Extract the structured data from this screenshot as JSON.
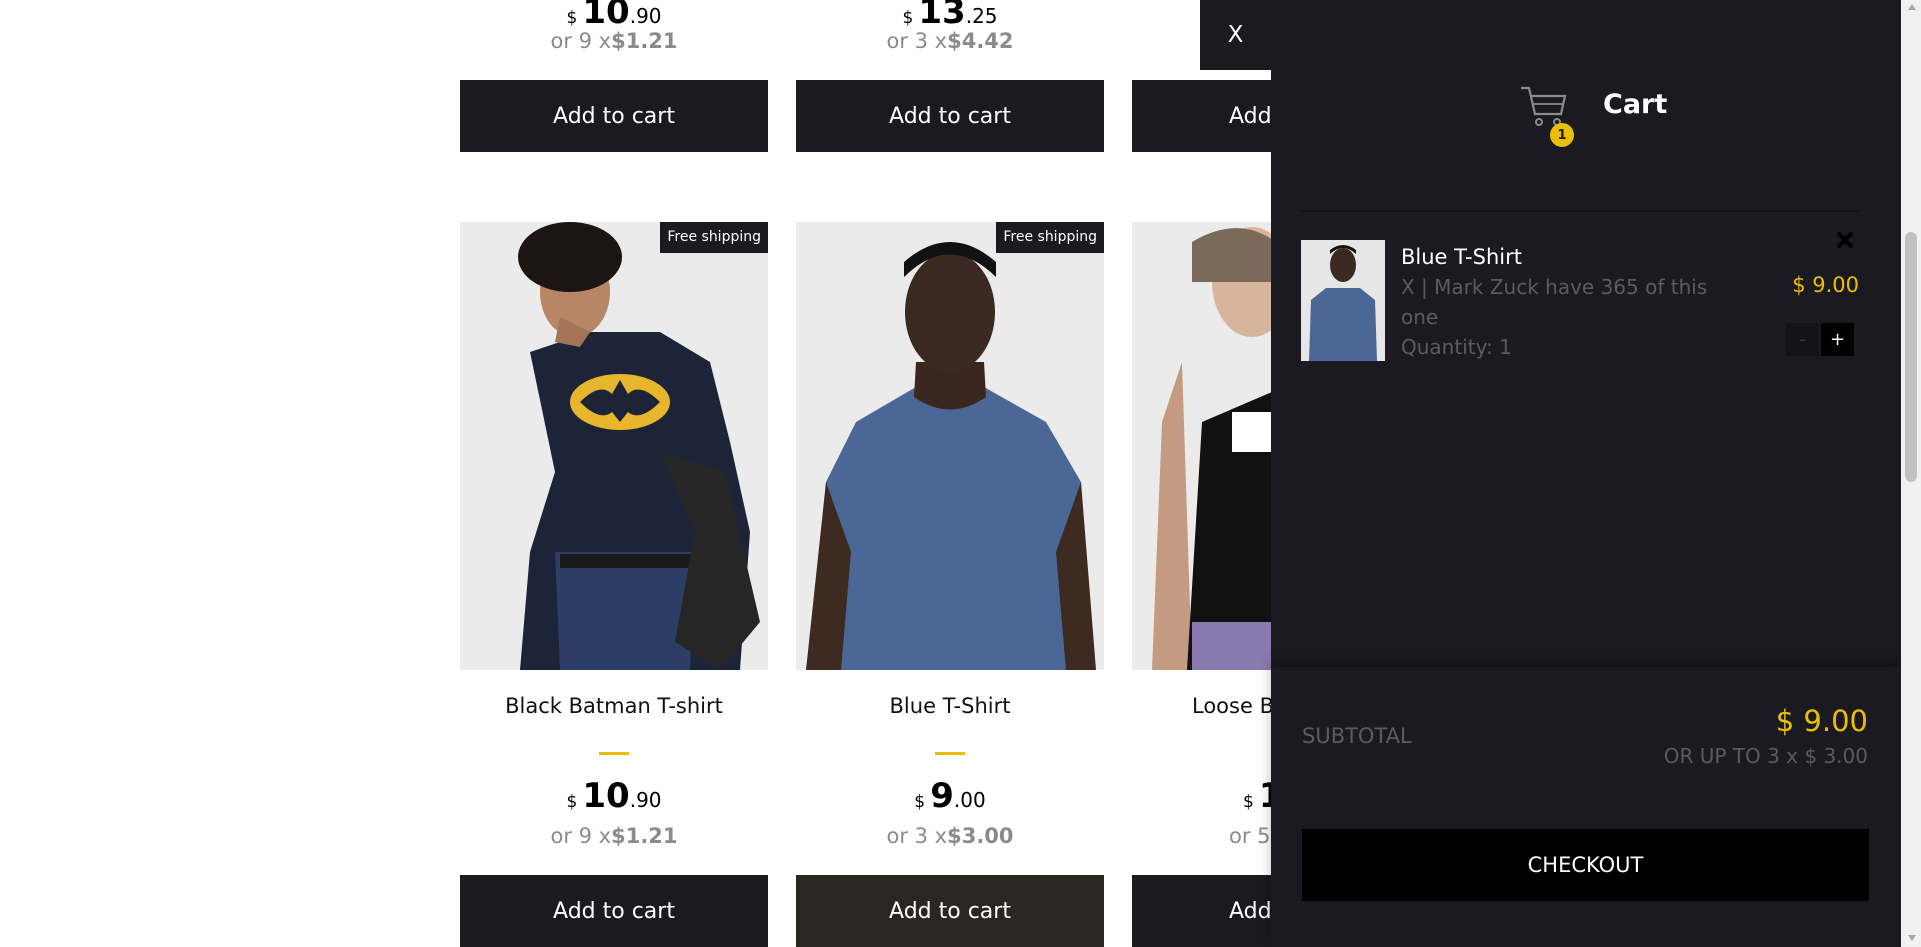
{
  "products_top": [
    {
      "price_int": "10",
      "price_dec": ".90",
      "currency": "$",
      "installment_prefix": "or 9 x",
      "installment_value": "$1.21",
      "button": "Add to cart"
    },
    {
      "price_int": "13",
      "price_dec": ".25",
      "currency": "$",
      "installment_prefix": "or 3 x",
      "installment_value": "$4.42",
      "button": "Add to cart"
    },
    {
      "button": "Add"
    }
  ],
  "products": [
    {
      "title": "Black Batman T-shirt",
      "badge": "Free shipping",
      "currency": "$",
      "price_int": "10",
      "price_dec": ".90",
      "installment_prefix": "or 9 x",
      "installment_value": "$1.21",
      "button": "Add to cart"
    },
    {
      "title": "Blue T-Shirt",
      "badge": "Free shipping",
      "currency": "$",
      "price_int": "9",
      "price_dec": ".00",
      "installment_prefix": "or 3 x",
      "installment_value": "$3.00",
      "button": "Add to cart"
    },
    {
      "title": "Loose B",
      "currency": "$",
      "price_int": "1",
      "installment_prefix": "or 5",
      "button": "Add"
    }
  ],
  "cart": {
    "close_label": "X",
    "title": "Cart",
    "badge_count": "1",
    "items": [
      {
        "name": "Blue T-Shirt",
        "desc_line1": "X | Mark Zuck have 365 of this",
        "desc_line2": "one",
        "quantity": "Quantity: 1",
        "price": "$ 9.00",
        "minus": "-",
        "plus": "+"
      }
    ],
    "subtotal_label": "SUBTOTAL",
    "subtotal_value": "$ 9.00",
    "installments": "OR UP TO 3 x $ 3.00",
    "checkout_label": "CHECKOUT"
  },
  "colors": {
    "accent": "#eabf00",
    "dark": "#1b1a20"
  }
}
